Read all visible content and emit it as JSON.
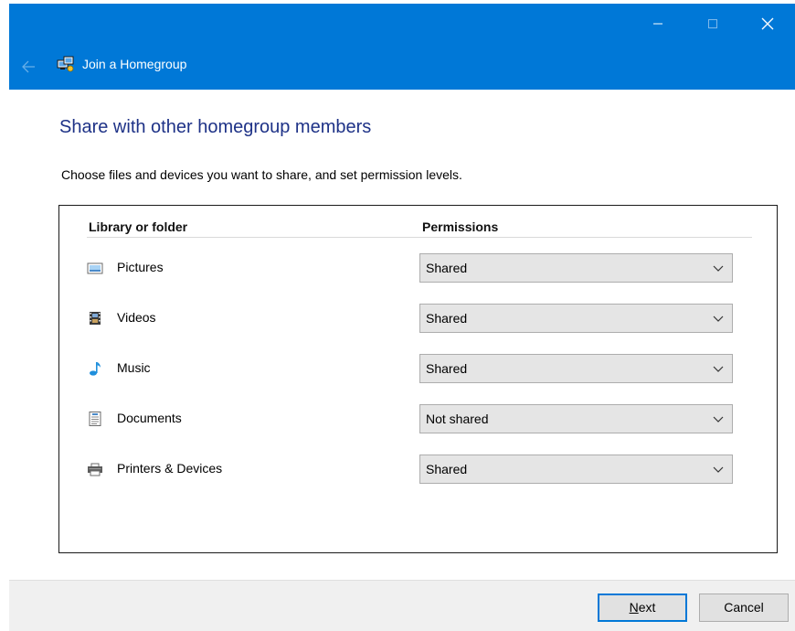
{
  "window": {
    "title": "Join a Homegroup",
    "accent_color": "#0078d7",
    "controls": [
      "minimize-icon",
      "maximize-icon",
      "close-icon"
    ]
  },
  "page": {
    "heading": "Share with other homegroup members",
    "subtitle": "Choose files and devices you want to share, and set permission levels."
  },
  "table": {
    "headers": {
      "library": "Library or folder",
      "permissions": "Permissions"
    },
    "rows": [
      {
        "label": "Pictures",
        "icon": "pictures-icon",
        "permission": "Shared"
      },
      {
        "label": "Videos",
        "icon": "videos-icon",
        "permission": "Shared"
      },
      {
        "label": "Music",
        "icon": "music-icon",
        "permission": "Shared"
      },
      {
        "label": "Documents",
        "icon": "documents-icon",
        "permission": "Not shared"
      },
      {
        "label": "Printers & Devices",
        "icon": "printer-icon",
        "permission": "Shared"
      }
    ]
  },
  "footer": {
    "next_accel": "N",
    "next_rest": "ext",
    "cancel_label": "Cancel"
  }
}
